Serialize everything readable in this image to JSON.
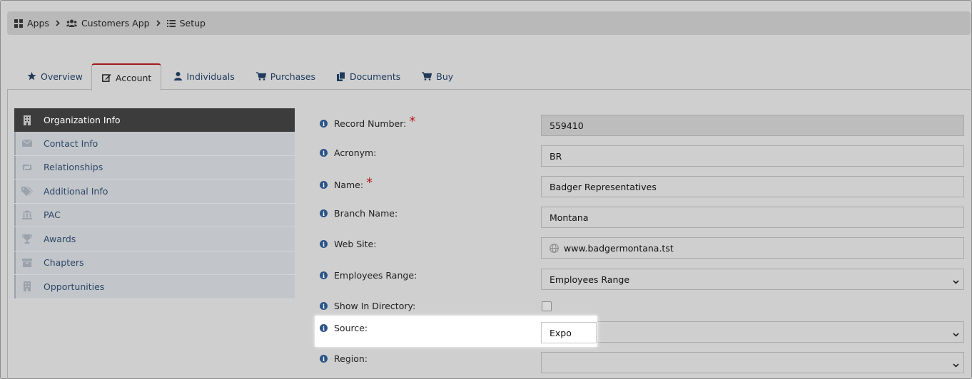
{
  "breadcrumb": [
    {
      "label": "Apps",
      "icon": "grid-icon"
    },
    {
      "label": "Customers App",
      "icon": "users-icon"
    },
    {
      "label": "Setup",
      "icon": "list-icon"
    }
  ],
  "tabs": [
    {
      "label": "Overview",
      "icon": "star-icon"
    },
    {
      "label": "Account",
      "icon": "edit-icon",
      "active": true
    },
    {
      "label": "Individuals",
      "icon": "user-icon"
    },
    {
      "label": "Purchases",
      "icon": "cart-icon"
    },
    {
      "label": "Documents",
      "icon": "copy-icon"
    },
    {
      "label": "Buy",
      "icon": "cart-icon"
    }
  ],
  "sidenav": [
    {
      "label": "Organization Info",
      "icon": "building-icon",
      "active": true
    },
    {
      "label": "Contact Info",
      "icon": "envelope-icon"
    },
    {
      "label": "Relationships",
      "icon": "retweet-icon"
    },
    {
      "label": "Additional Info",
      "icon": "tags-icon"
    },
    {
      "label": "PAC",
      "icon": "bank-icon"
    },
    {
      "label": "Awards",
      "icon": "trophy-icon"
    },
    {
      "label": "Chapters",
      "icon": "archive-icon"
    },
    {
      "label": "Opportunities",
      "icon": "building-icon"
    }
  ],
  "form": {
    "record_number": {
      "label": "Record Number:",
      "value": "559410",
      "required": true
    },
    "acronym": {
      "label": "Acronym:",
      "value": "BR"
    },
    "name": {
      "label": "Name:",
      "value": "Badger Representatives",
      "required": true
    },
    "branch_name": {
      "label": "Branch Name:",
      "value": "Montana"
    },
    "web_site": {
      "label": "Web Site:",
      "value": "www.badgermontana.tst"
    },
    "employees_range": {
      "label": "Employees Range:",
      "value": "Employees Range"
    },
    "show_in_directory": {
      "label": "Show In Directory:",
      "checked": false
    },
    "source": {
      "label": "Source:",
      "value": "Expo"
    },
    "region": {
      "label": "Region:",
      "value": ""
    }
  },
  "required_mark": "*",
  "info_mark": "i",
  "colors": {
    "accent_tab_border": "#a31b1b",
    "link_blue": "#203a5c",
    "active_nav_bg": "#3c3c3c",
    "info_icon": "#2b5488",
    "required": "#b01818"
  }
}
